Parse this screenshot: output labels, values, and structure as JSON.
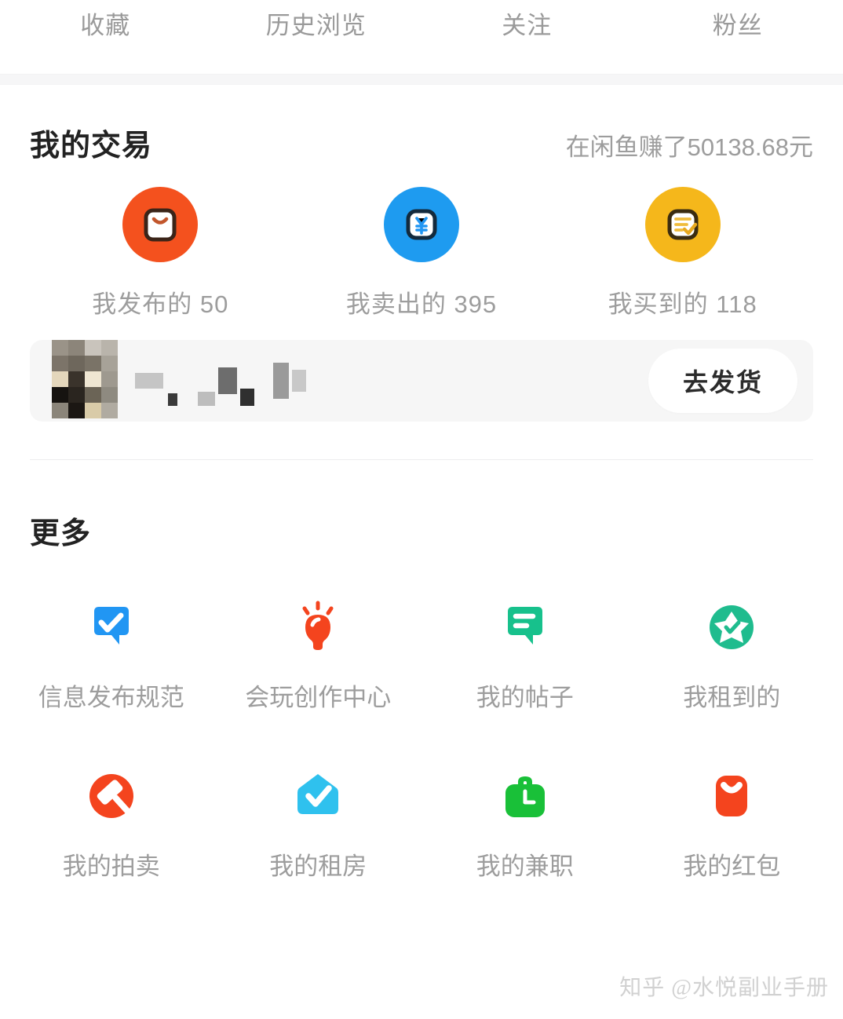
{
  "topnav": {
    "items": [
      {
        "label": "收藏",
        "name": "favorites"
      },
      {
        "label": "历史浏览",
        "name": "history"
      },
      {
        "label": "关注",
        "name": "following"
      },
      {
        "label": "粉丝",
        "name": "followers"
      }
    ]
  },
  "trade": {
    "title": "我的交易",
    "earnings": "在闲鱼赚了50138.68元",
    "items": [
      {
        "label": "我发布的 50",
        "icon": "shopping-bag-icon",
        "color": "#F4511E"
      },
      {
        "label": "我卖出的 395",
        "icon": "yen-money-icon",
        "color": "#1E9BF0"
      },
      {
        "label": "我买到的 118",
        "icon": "order-list-check-icon",
        "color": "#F5B71B"
      }
    ],
    "order": {
      "ship_button": "去发货",
      "thumb_blurred": true,
      "title_blurred": true
    }
  },
  "more": {
    "title": "更多",
    "items": [
      {
        "label": "信息发布规范",
        "icon": "speech-bubble-check-icon",
        "color": "#2196F3"
      },
      {
        "label": "会玩创作中心",
        "icon": "lightbulb-idea-icon",
        "color": "#F4441E"
      },
      {
        "label": "我的帖子",
        "icon": "speech-bubble-lines-icon",
        "color": "#17C18C"
      },
      {
        "label": "我租到的",
        "icon": "star-check-circle-icon",
        "color": "#1FBC8E"
      },
      {
        "label": "我的拍卖",
        "icon": "gavel-auction-icon",
        "color": "#F4441E"
      },
      {
        "label": "我的租房",
        "icon": "house-check-icon",
        "color": "#2FC1EE"
      },
      {
        "label": "我的兼职",
        "icon": "briefcase-clock-icon",
        "color": "#19C038"
      },
      {
        "label": "我的红包",
        "icon": "red-packet-icon",
        "color": "#F4441E"
      }
    ]
  },
  "watermark": {
    "text": "知乎 @水悦副业手册"
  },
  "colors": {
    "bg": "#ffffff",
    "muted_text": "#9d9d9d",
    "heading_text": "#222222",
    "card_bg": "#f6f6f6",
    "divider": "#ededee"
  }
}
